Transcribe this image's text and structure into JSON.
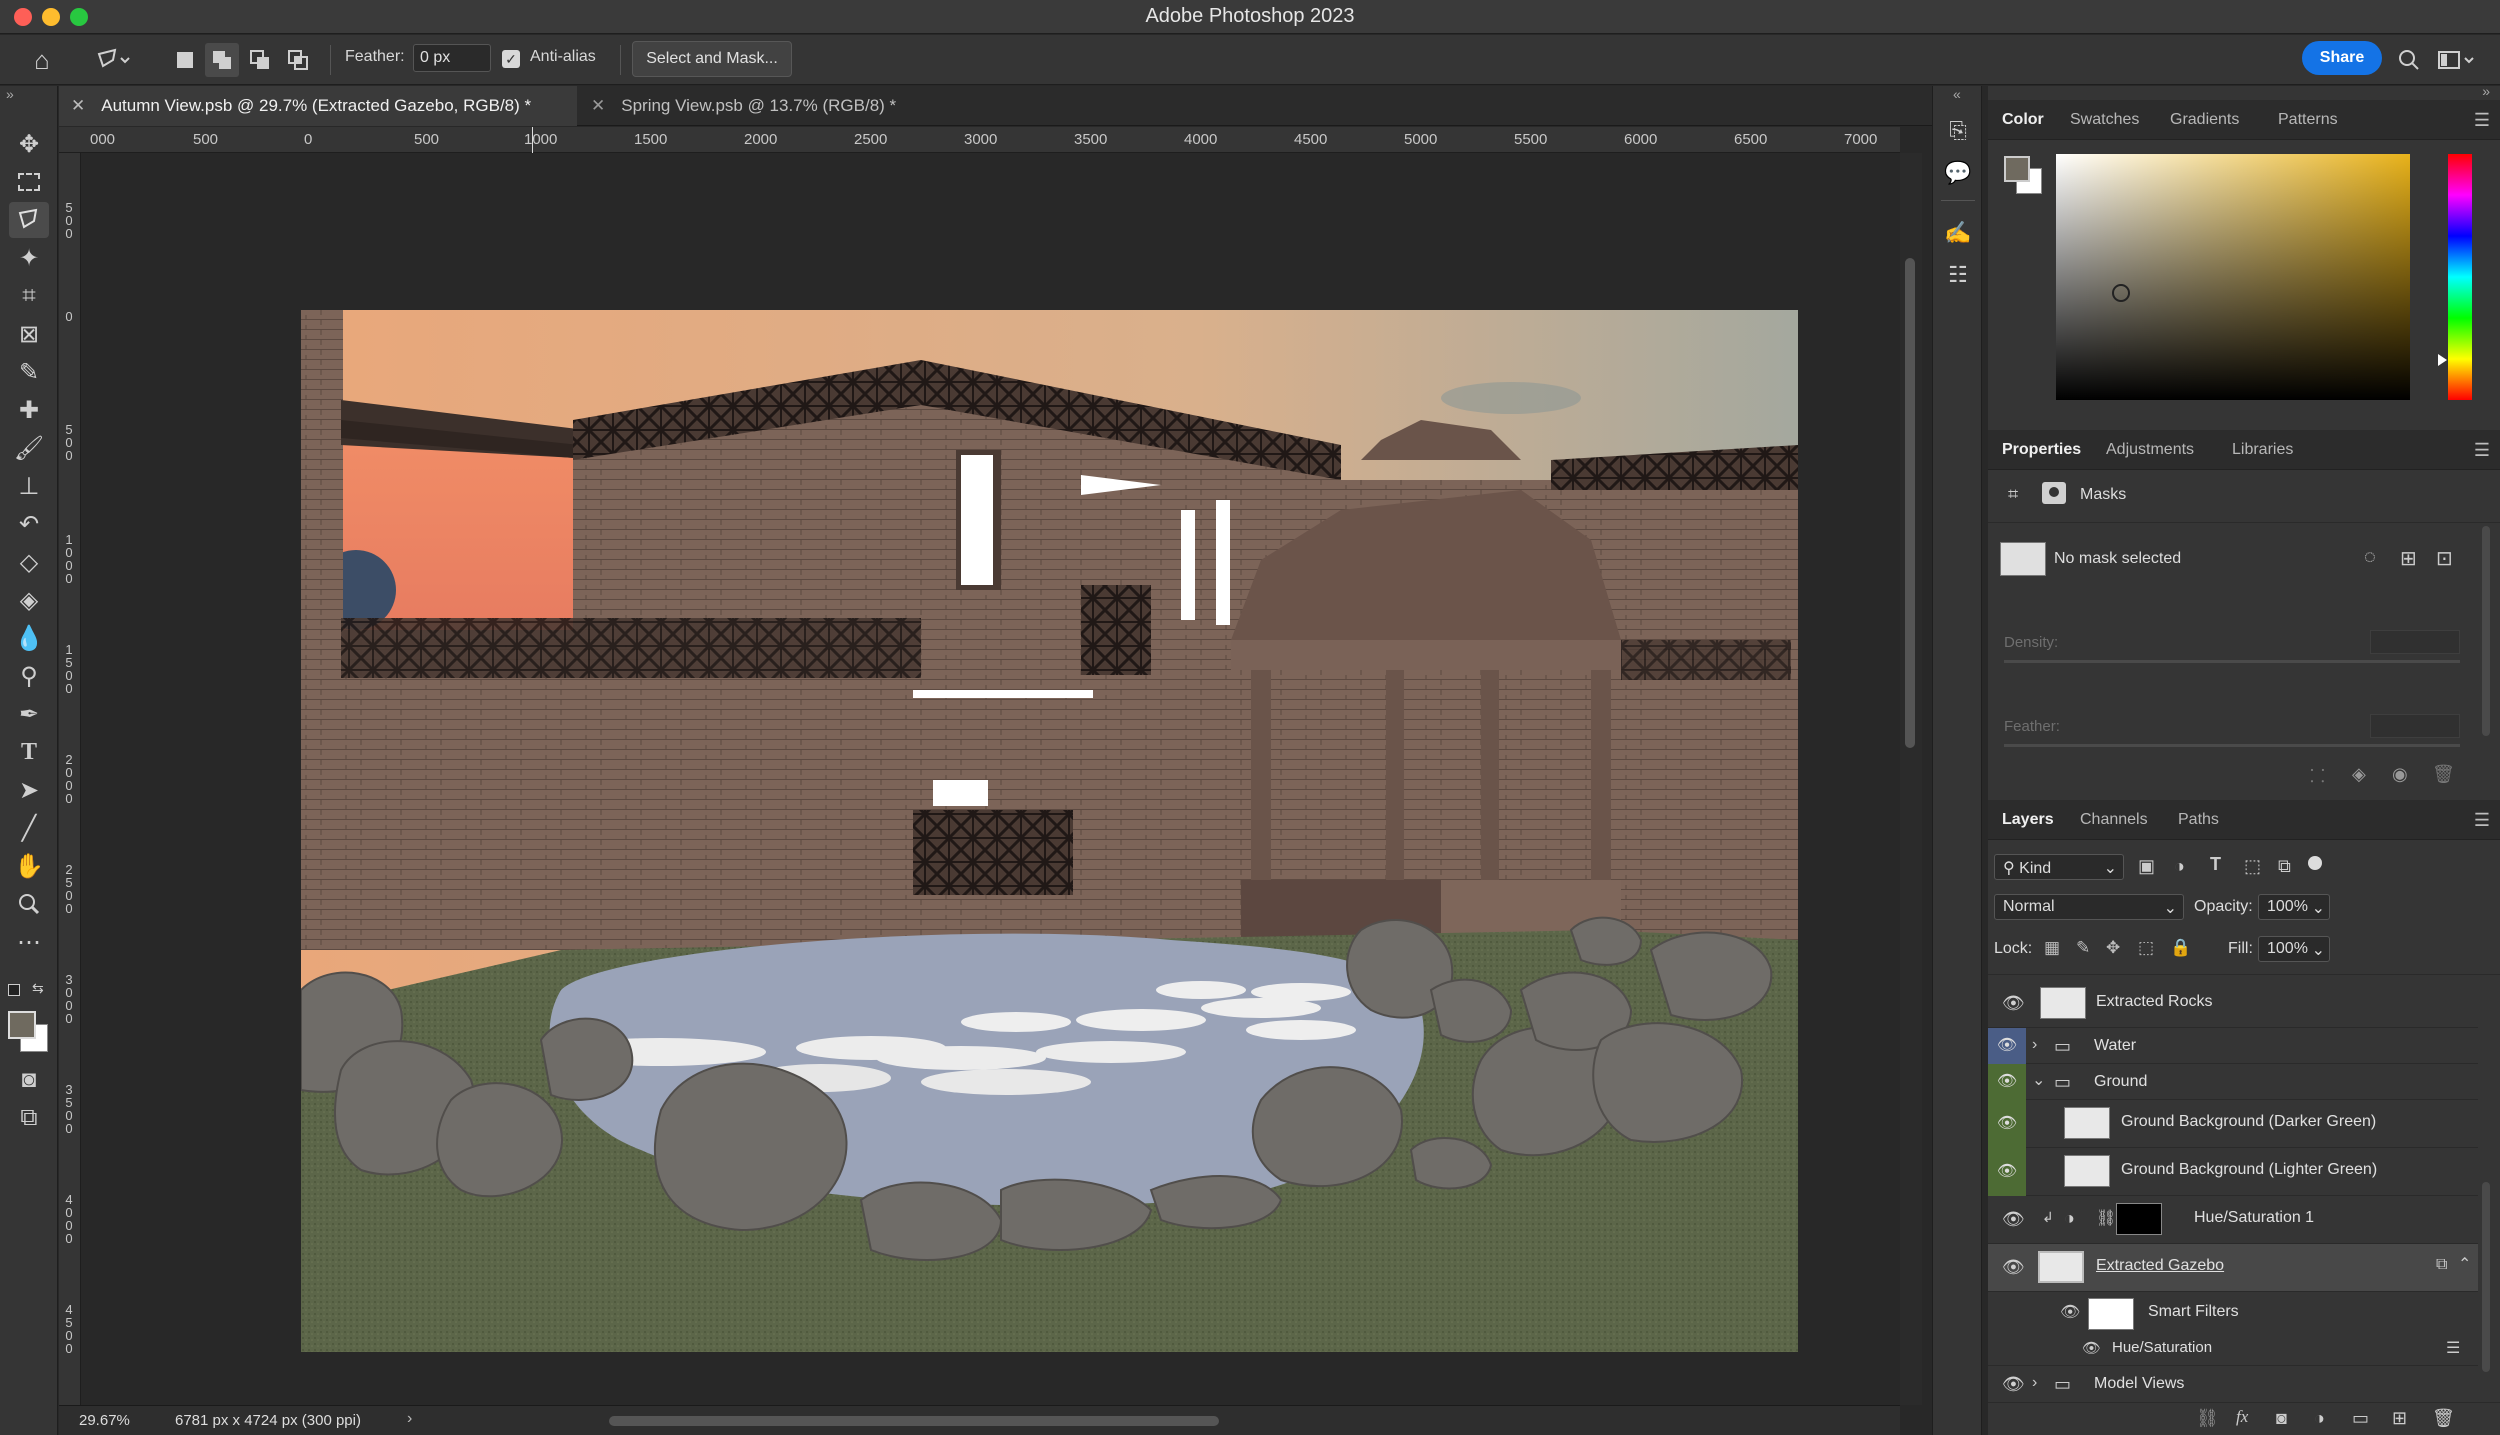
{
  "app": {
    "title": "Adobe Photoshop 2023"
  },
  "options_bar": {
    "feather_label": "Feather:",
    "feather_value": "0 px",
    "antialias_label": "Anti-alias",
    "antialias_checked": true,
    "select_mask_label": "Select and Mask...",
    "share_label": "Share"
  },
  "tabs": [
    {
      "label": "Autumn View.psb @ 29.7% (Extracted Gazebo, RGB/8) *",
      "active": true
    },
    {
      "label": "Spring View.psb @ 13.7% (RGB/8) *",
      "active": false
    }
  ],
  "ruler_h": [
    "000",
    "500",
    "0",
    "500",
    "1000",
    "1500",
    "2000",
    "2500",
    "3000",
    "3500",
    "4000",
    "4500",
    "5000",
    "5500",
    "6000",
    "6500",
    "7000"
  ],
  "ruler_v": [
    "500",
    "0",
    "500",
    "1000",
    "1500",
    "2000",
    "2500",
    "3000",
    "3500",
    "4000",
    "4500"
  ],
  "status": {
    "zoom": "29.67%",
    "doc_info": "6781 px x 4724 px (300 ppi)"
  },
  "color_panel": {
    "tabs": [
      "Color",
      "Swatches",
      "Gradients",
      "Patterns"
    ],
    "active_tab": "Color",
    "hue_color": "#e8b21a"
  },
  "properties_panel": {
    "tabs": [
      "Properties",
      "Adjustments",
      "Libraries"
    ],
    "active_tab": "Properties",
    "section": "Masks",
    "mask_status": "No mask selected",
    "density_label": "Density:",
    "feather_label": "Feather:"
  },
  "layers_panel": {
    "tabs": [
      "Layers",
      "Channels",
      "Paths"
    ],
    "active_tab": "Layers",
    "filter_kind": "Kind",
    "blend_mode": "Normal",
    "opacity_label": "Opacity:",
    "opacity_value": "100%",
    "lock_label": "Lock:",
    "fill_label": "Fill:",
    "fill_value": "100%",
    "layers": [
      {
        "name": "Extracted Rocks",
        "type": "layer"
      },
      {
        "name": "Water",
        "type": "group",
        "expanded": false,
        "eye_color": "#4a5d86"
      },
      {
        "name": "Ground",
        "type": "group",
        "expanded": true,
        "eye_color": "#4d6b34"
      },
      {
        "name": "Ground Background (Darker Green)",
        "type": "layer",
        "eye_color": "#4d6b34"
      },
      {
        "name": "Ground Background (Lighter Green)",
        "type": "layer",
        "eye_color": "#4d6b34"
      },
      {
        "name": "Hue/Saturation 1",
        "type": "adjustment"
      },
      {
        "name": "Extracted Gazebo",
        "type": "smart",
        "selected": true
      },
      {
        "name": "Smart Filters",
        "type": "filter-mask"
      },
      {
        "name": "Hue/Saturation",
        "type": "filter"
      },
      {
        "name": "Model Views",
        "type": "group",
        "expanded": false
      }
    ]
  }
}
